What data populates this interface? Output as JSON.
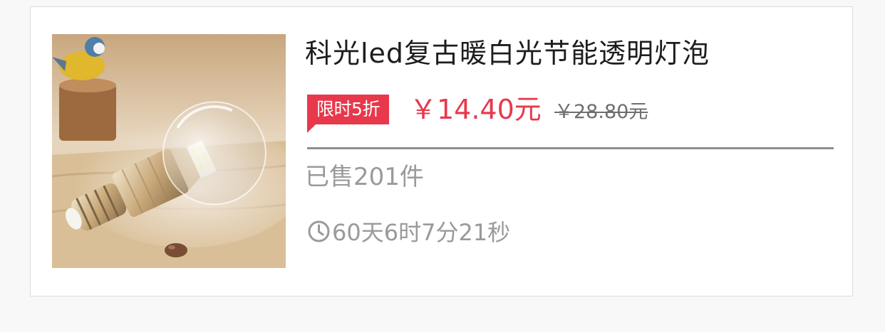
{
  "product": {
    "image_icon": "led-bulb-photo",
    "title": "科光led复古暖白光节能透明灯泡",
    "badge": "限时5折",
    "price": "￥14.40元",
    "original_price": "￥28.80元",
    "sold": "已售201件",
    "countdown": "60天6时7分21秒",
    "clock_icon": "clock-icon"
  },
  "colors": {
    "accent": "#e8384b",
    "muted_text": "#9a9a9a",
    "title_text": "#1d1d1d",
    "divider": "#8e8e8e"
  }
}
